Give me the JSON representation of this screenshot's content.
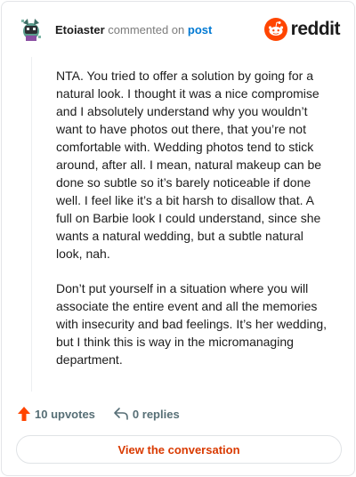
{
  "header": {
    "username": "Etoiaster",
    "action_text": "commented on",
    "post_link": "post",
    "brand_name": "reddit",
    "brand_color": "#ff4500"
  },
  "comment": {
    "paragraphs": [
      "NTA. You tried to offer a solution by going for a natural look. I thought it was a nice compromise and I absolutely understand why you wouldn’t want to have photos out there, that you’re not comfortable with. Wedding photos tend to stick around, after all. I mean, natural makeup can be done so subtle so it’s barely noticeable if done well. I feel like it’s a bit harsh to disallow that. A full on Barbie look I could understand, since she wants a natural wedding, but a subtle natural look, nah.",
      "Don’t put yourself in a situation where you will associate the entire event and all the memories with insecurity and bad feelings. It’s her wedding, but I think this is way in the micromanaging department."
    ]
  },
  "actions": {
    "upvotes": "10 upvotes",
    "replies": "0 replies",
    "upvote_icon": "upvote-arrow-icon",
    "reply_icon": "reply-arrow-icon"
  },
  "footer": {
    "view_button": "View the conversation",
    "accent_color": "#d93a00"
  }
}
